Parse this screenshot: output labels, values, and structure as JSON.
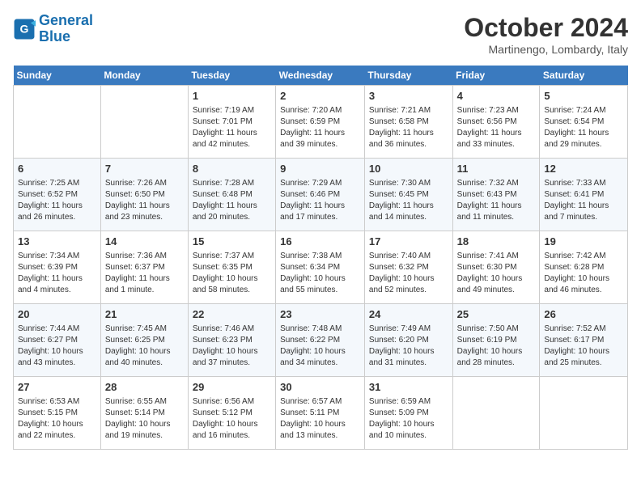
{
  "header": {
    "logo_line1": "General",
    "logo_line2": "Blue",
    "month": "October 2024",
    "location": "Martinengo, Lombardy, Italy"
  },
  "weekdays": [
    "Sunday",
    "Monday",
    "Tuesday",
    "Wednesday",
    "Thursday",
    "Friday",
    "Saturday"
  ],
  "weeks": [
    [
      {
        "day": "",
        "content": ""
      },
      {
        "day": "",
        "content": ""
      },
      {
        "day": "1",
        "content": "Sunrise: 7:19 AM\nSunset: 7:01 PM\nDaylight: 11 hours\nand 42 minutes."
      },
      {
        "day": "2",
        "content": "Sunrise: 7:20 AM\nSunset: 6:59 PM\nDaylight: 11 hours\nand 39 minutes."
      },
      {
        "day": "3",
        "content": "Sunrise: 7:21 AM\nSunset: 6:58 PM\nDaylight: 11 hours\nand 36 minutes."
      },
      {
        "day": "4",
        "content": "Sunrise: 7:23 AM\nSunset: 6:56 PM\nDaylight: 11 hours\nand 33 minutes."
      },
      {
        "day": "5",
        "content": "Sunrise: 7:24 AM\nSunset: 6:54 PM\nDaylight: 11 hours\nand 29 minutes."
      }
    ],
    [
      {
        "day": "6",
        "content": "Sunrise: 7:25 AM\nSunset: 6:52 PM\nDaylight: 11 hours\nand 26 minutes."
      },
      {
        "day": "7",
        "content": "Sunrise: 7:26 AM\nSunset: 6:50 PM\nDaylight: 11 hours\nand 23 minutes."
      },
      {
        "day": "8",
        "content": "Sunrise: 7:28 AM\nSunset: 6:48 PM\nDaylight: 11 hours\nand 20 minutes."
      },
      {
        "day": "9",
        "content": "Sunrise: 7:29 AM\nSunset: 6:46 PM\nDaylight: 11 hours\nand 17 minutes."
      },
      {
        "day": "10",
        "content": "Sunrise: 7:30 AM\nSunset: 6:45 PM\nDaylight: 11 hours\nand 14 minutes."
      },
      {
        "day": "11",
        "content": "Sunrise: 7:32 AM\nSunset: 6:43 PM\nDaylight: 11 hours\nand 11 minutes."
      },
      {
        "day": "12",
        "content": "Sunrise: 7:33 AM\nSunset: 6:41 PM\nDaylight: 11 hours\nand 7 minutes."
      }
    ],
    [
      {
        "day": "13",
        "content": "Sunrise: 7:34 AM\nSunset: 6:39 PM\nDaylight: 11 hours\nand 4 minutes."
      },
      {
        "day": "14",
        "content": "Sunrise: 7:36 AM\nSunset: 6:37 PM\nDaylight: 11 hours\nand 1 minute."
      },
      {
        "day": "15",
        "content": "Sunrise: 7:37 AM\nSunset: 6:35 PM\nDaylight: 10 hours\nand 58 minutes."
      },
      {
        "day": "16",
        "content": "Sunrise: 7:38 AM\nSunset: 6:34 PM\nDaylight: 10 hours\nand 55 minutes."
      },
      {
        "day": "17",
        "content": "Sunrise: 7:40 AM\nSunset: 6:32 PM\nDaylight: 10 hours\nand 52 minutes."
      },
      {
        "day": "18",
        "content": "Sunrise: 7:41 AM\nSunset: 6:30 PM\nDaylight: 10 hours\nand 49 minutes."
      },
      {
        "day": "19",
        "content": "Sunrise: 7:42 AM\nSunset: 6:28 PM\nDaylight: 10 hours\nand 46 minutes."
      }
    ],
    [
      {
        "day": "20",
        "content": "Sunrise: 7:44 AM\nSunset: 6:27 PM\nDaylight: 10 hours\nand 43 minutes."
      },
      {
        "day": "21",
        "content": "Sunrise: 7:45 AM\nSunset: 6:25 PM\nDaylight: 10 hours\nand 40 minutes."
      },
      {
        "day": "22",
        "content": "Sunrise: 7:46 AM\nSunset: 6:23 PM\nDaylight: 10 hours\nand 37 minutes."
      },
      {
        "day": "23",
        "content": "Sunrise: 7:48 AM\nSunset: 6:22 PM\nDaylight: 10 hours\nand 34 minutes."
      },
      {
        "day": "24",
        "content": "Sunrise: 7:49 AM\nSunset: 6:20 PM\nDaylight: 10 hours\nand 31 minutes."
      },
      {
        "day": "25",
        "content": "Sunrise: 7:50 AM\nSunset: 6:19 PM\nDaylight: 10 hours\nand 28 minutes."
      },
      {
        "day": "26",
        "content": "Sunrise: 7:52 AM\nSunset: 6:17 PM\nDaylight: 10 hours\nand 25 minutes."
      }
    ],
    [
      {
        "day": "27",
        "content": "Sunrise: 6:53 AM\nSunset: 5:15 PM\nDaylight: 10 hours\nand 22 minutes."
      },
      {
        "day": "28",
        "content": "Sunrise: 6:55 AM\nSunset: 5:14 PM\nDaylight: 10 hours\nand 19 minutes."
      },
      {
        "day": "29",
        "content": "Sunrise: 6:56 AM\nSunset: 5:12 PM\nDaylight: 10 hours\nand 16 minutes."
      },
      {
        "day": "30",
        "content": "Sunrise: 6:57 AM\nSunset: 5:11 PM\nDaylight: 10 hours\nand 13 minutes."
      },
      {
        "day": "31",
        "content": "Sunrise: 6:59 AM\nSunset: 5:09 PM\nDaylight: 10 hours\nand 10 minutes."
      },
      {
        "day": "",
        "content": ""
      },
      {
        "day": "",
        "content": ""
      }
    ]
  ]
}
